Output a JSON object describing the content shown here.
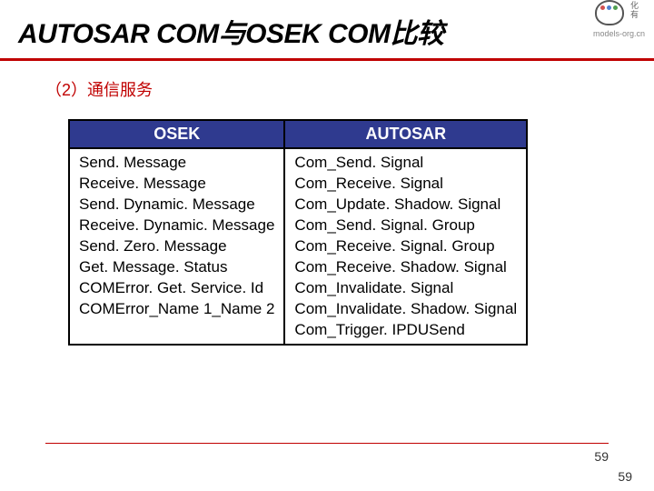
{
  "header": {
    "title": "AUTOSAR COM与OSEK COM比较",
    "logo_chinese_1": "化",
    "logo_chinese_2": "有",
    "logo_url": "models-org.cn"
  },
  "section": {
    "subtitle": "（2）通信服务"
  },
  "table": {
    "headers": {
      "left": "OSEK",
      "right": "AUTOSAR"
    },
    "left_items": [
      "Send. Message",
      "Receive. Message",
      "Send. Dynamic. Message",
      "Receive. Dynamic. Message",
      "Send. Zero. Message",
      "Get. Message. Status",
      "COMError. Get. Service. Id",
      "COMError_Name 1_Name 2"
    ],
    "right_items": [
      "Com_Send. Signal",
      "Com_Receive. Signal",
      "Com_Update. Shadow. Signal",
      "Com_Send. Signal. Group",
      "Com_Receive. Signal. Group",
      "Com_Receive. Shadow. Signal",
      "Com_Invalidate. Signal",
      "Com_Invalidate. Shadow. Signal",
      "Com_Trigger. IPDUSend"
    ]
  },
  "footer": {
    "page_inner": "59",
    "page_outer": "59"
  }
}
